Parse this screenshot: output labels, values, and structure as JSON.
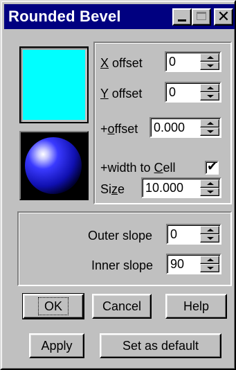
{
  "window": {
    "title": "Rounded Bevel",
    "controls": {
      "minimize": "minimize",
      "maximize": "maximize (disabled)",
      "close": "✕"
    }
  },
  "swatch": {
    "color": "#00ffff"
  },
  "preview": {
    "description": "blue sphere"
  },
  "fields": {
    "x_offset": {
      "label_underlined": "X",
      "label_rest": " offset",
      "value": "0"
    },
    "y_offset": {
      "label_underlined": "Y",
      "label_rest": " offset",
      "value": "0"
    },
    "plus_offset": {
      "label_prefix": "+",
      "label_underlined": "o",
      "label_rest": "ffset",
      "value": "0.000"
    },
    "width_to_cell": {
      "label_prefix": "+width to ",
      "label_underlined": "C",
      "label_rest": "ell",
      "checked": true,
      "mark": "✔"
    },
    "size": {
      "label_prefix": "Si",
      "label_underlined": "z",
      "label_rest": "e",
      "value": "10.000"
    },
    "outer_slope": {
      "label": "Outer slope",
      "value": "0"
    },
    "inner_slope": {
      "label": "Inner slope",
      "value": "90"
    }
  },
  "buttons": {
    "ok": "OK",
    "cancel": "Cancel",
    "help": "Help",
    "apply": "Apply",
    "set_default": "Set as default"
  },
  "colors": {
    "titlebar": "#000080",
    "face": "#c0c0c0",
    "swatch": "#00ffff"
  }
}
